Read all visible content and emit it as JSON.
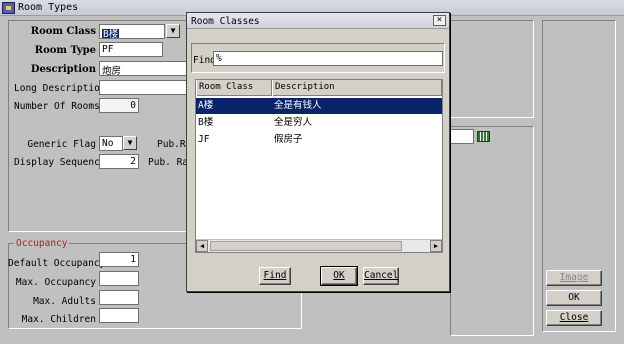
{
  "window": {
    "title": "Room Types"
  },
  "form": {
    "room_class_label": "Room Class",
    "room_class_value": "B楼",
    "room_type_label": "Room Type",
    "room_type_value": "PF",
    "description_label": "Description",
    "description_value": "炮房",
    "long_description_label": "Long Description",
    "long_description_value": "",
    "number_of_rooms_label": "Number Of Rooms",
    "number_of_rooms_value": "0",
    "generic_flag_label": "Generic Flag",
    "generic_flag_value": "No",
    "display_sequence_label": "Display Sequence",
    "display_sequence_value": "2",
    "pub_rate_label_1": "Pub.Ra",
    "pub_rate_label_2": "Pub. Rat"
  },
  "occupancy": {
    "legend": "Occupancy",
    "default_label": "Default Occupancy",
    "default_value": "1",
    "max_label": "Max. Occupancy",
    "max_value": "",
    "adults_label": "Max. Adults",
    "adults_value": "",
    "children_label": "Max. Children",
    "children_value": ""
  },
  "right_buttons": {
    "image": "Image",
    "ok": "OK",
    "close": "Close"
  },
  "modal": {
    "title": "Room Classes",
    "close_glyph": "×",
    "find_label": "Find",
    "find_value": "%",
    "columns": [
      "Room Class",
      "Description"
    ],
    "rows": [
      {
        "room_class": "A楼",
        "description": "全是有钱人"
      },
      {
        "room_class": "B楼",
        "description": "全是穷人"
      },
      {
        "room_class": "JF",
        "description": "假房子"
      }
    ],
    "buttons": {
      "find": "Find",
      "ok": "OK",
      "cancel": "Cancel"
    }
  },
  "icons": {
    "app": "app-icon",
    "dropdown": "chevron-down-icon",
    "calendar": "calendar-icon",
    "scroll_left": "arrow-left-icon",
    "scroll_right": "arrow-right-icon"
  }
}
